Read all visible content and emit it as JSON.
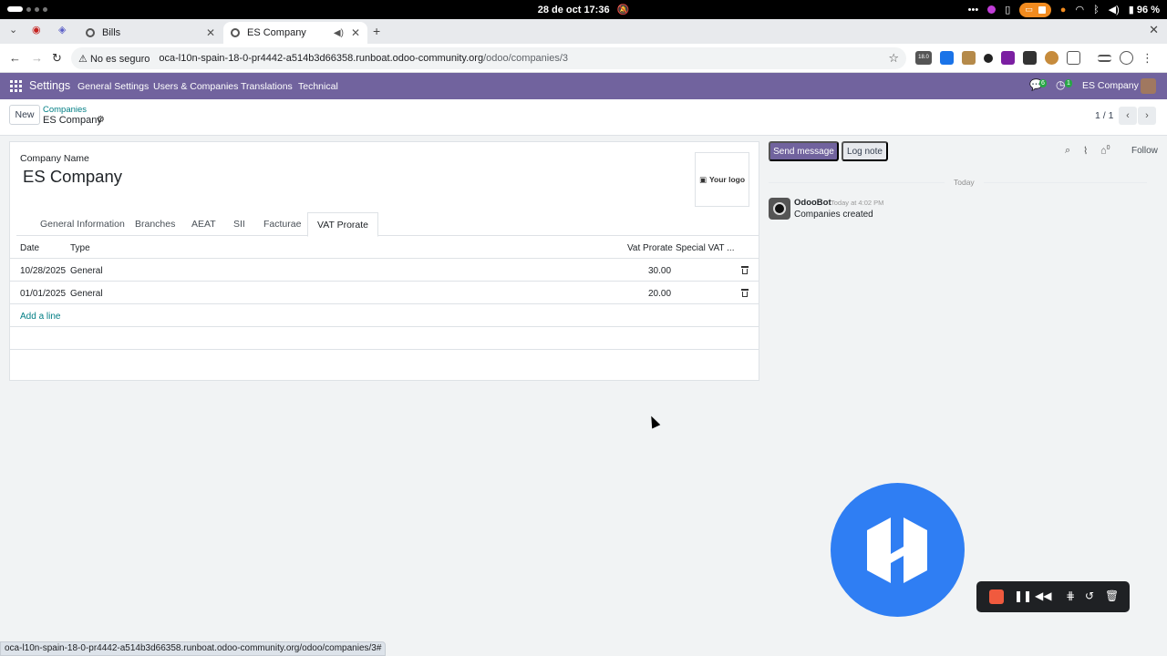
{
  "os": {
    "clock": "28 de oct  17:36",
    "battery": "96 %",
    "icons": [
      "more-icon",
      "color-app-icon",
      "clipboard-icon",
      "screen-record-icon",
      "mic-icon",
      "wifi-icon",
      "bluetooth-icon",
      "volume-icon",
      "battery-icon"
    ]
  },
  "browser": {
    "tabs": [
      {
        "title": "Bills",
        "active": false
      },
      {
        "title": "ES Company",
        "active": true
      }
    ],
    "security_label": "No es seguro",
    "url_host": "oca-l10n-spain-18-0-pr4442-a514b3d66358.runboat.odoo-community.org",
    "url_path": "/odoo/companies/3",
    "status_url": "oca-l10n-spain-18-0-pr4442-a514b3d66358.runboat.odoo-community.org/odoo/companies/3#",
    "extension_badge": "18.0"
  },
  "navbar": {
    "app_title": "Settings",
    "menus": [
      "General Settings",
      "Users & Companies",
      "Translations",
      "Technical"
    ],
    "messages_count": "6",
    "activities_count": "1",
    "company": "ES Company"
  },
  "control_panel": {
    "new_label": "New",
    "breadcrumb_parent": "Companies",
    "breadcrumb_current": "ES Company",
    "pager": "1 / 1"
  },
  "form": {
    "name_label": "Company Name",
    "company_name": "ES Company",
    "logo_text": "Your logo",
    "tabs": [
      "General Information",
      "Branches",
      "AEAT",
      "SII",
      "Facturae",
      "VAT Prorate"
    ],
    "active_tab": "VAT Prorate",
    "table": {
      "headers": [
        "Date",
        "Type",
        "Vat Prorate",
        "Special VAT ..."
      ],
      "rows": [
        {
          "date": "10/28/2025",
          "type": "General",
          "vat_prorate": "30.00",
          "special_vat": ""
        },
        {
          "date": "01/01/2025",
          "type": "General",
          "vat_prorate": "20.00",
          "special_vat": ""
        }
      ],
      "add_line": "Add a line"
    }
  },
  "chatter": {
    "send_message": "Send message",
    "log_note": "Log note",
    "followers_count": "0",
    "follow": "Follow",
    "date_separator": "Today",
    "messages": [
      {
        "author": "OdooBot",
        "time": "Today at 4:02 PM",
        "body": "Companies created"
      }
    ]
  },
  "colors": {
    "odoo_primary": "#71639e",
    "link": "#017e84",
    "overlay_logo": "#2f7ef3",
    "record_stop": "#f05a3e"
  }
}
